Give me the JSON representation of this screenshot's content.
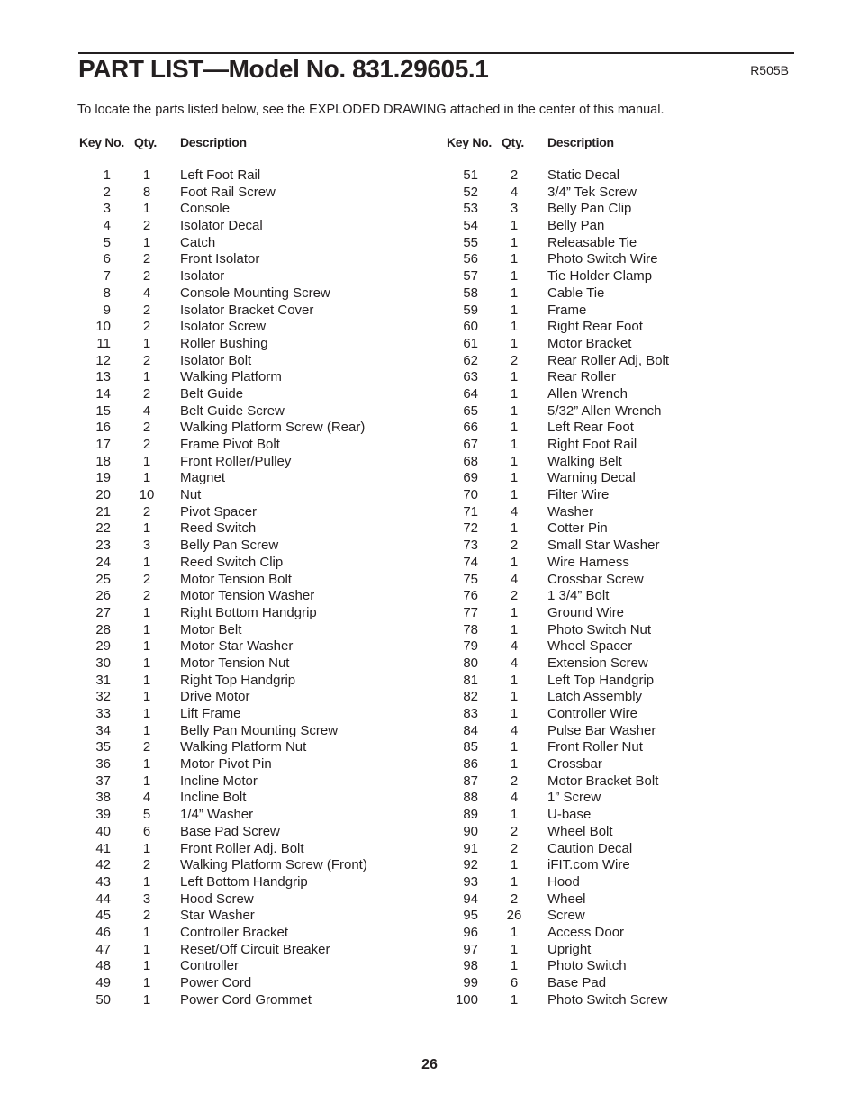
{
  "header": {
    "title": "PART LIST—Model No. 831.29605.1",
    "code": "R505B",
    "intro": "To locate the parts listed below, see the EXPLODED DRAWING attached in the center of this manual."
  },
  "columns": {
    "key": "Key No.",
    "qty": "Qty.",
    "desc": "Description"
  },
  "left_parts": [
    {
      "key": "1",
      "qty": "1",
      "desc": "Left Foot Rail"
    },
    {
      "key": "2",
      "qty": "8",
      "desc": "Foot Rail Screw"
    },
    {
      "key": "3",
      "qty": "1",
      "desc": "Console"
    },
    {
      "key": "4",
      "qty": "2",
      "desc": "Isolator Decal"
    },
    {
      "key": "5",
      "qty": "1",
      "desc": "Catch"
    },
    {
      "key": "6",
      "qty": "2",
      "desc": "Front Isolator"
    },
    {
      "key": "7",
      "qty": "2",
      "desc": "Isolator"
    },
    {
      "key": "8",
      "qty": "4",
      "desc": "Console Mounting Screw"
    },
    {
      "key": "9",
      "qty": "2",
      "desc": "Isolator Bracket Cover"
    },
    {
      "key": "10",
      "qty": "2",
      "desc": "Isolator Screw"
    },
    {
      "key": "11",
      "qty": "1",
      "desc": "Roller Bushing"
    },
    {
      "key": "12",
      "qty": "2",
      "desc": "Isolator Bolt"
    },
    {
      "key": "13",
      "qty": "1",
      "desc": "Walking Platform"
    },
    {
      "key": "14",
      "qty": "2",
      "desc": "Belt Guide"
    },
    {
      "key": "15",
      "qty": "4",
      "desc": "Belt Guide Screw"
    },
    {
      "key": "16",
      "qty": "2",
      "desc": "Walking Platform Screw (Rear)"
    },
    {
      "key": "17",
      "qty": "2",
      "desc": "Frame Pivot Bolt"
    },
    {
      "key": "18",
      "qty": "1",
      "desc": "Front Roller/Pulley"
    },
    {
      "key": "19",
      "qty": "1",
      "desc": "Magnet"
    },
    {
      "key": "20",
      "qty": "10",
      "desc": "Nut"
    },
    {
      "key": "21",
      "qty": "2",
      "desc": "Pivot Spacer"
    },
    {
      "key": "22",
      "qty": "1",
      "desc": "Reed Switch"
    },
    {
      "key": "23",
      "qty": "3",
      "desc": "Belly Pan Screw"
    },
    {
      "key": "24",
      "qty": "1",
      "desc": "Reed Switch Clip"
    },
    {
      "key": "25",
      "qty": "2",
      "desc": "Motor Tension Bolt"
    },
    {
      "key": "26",
      "qty": "2",
      "desc": "Motor Tension Washer"
    },
    {
      "key": "27",
      "qty": "1",
      "desc": "Right Bottom Handgrip"
    },
    {
      "key": "28",
      "qty": "1",
      "desc": "Motor Belt"
    },
    {
      "key": "29",
      "qty": "1",
      "desc": "Motor Star Washer"
    },
    {
      "key": "30",
      "qty": "1",
      "desc": "Motor Tension Nut"
    },
    {
      "key": "31",
      "qty": "1",
      "desc": "Right Top Handgrip"
    },
    {
      "key": "32",
      "qty": "1",
      "desc": "Drive Motor"
    },
    {
      "key": "33",
      "qty": "1",
      "desc": "Lift Frame"
    },
    {
      "key": "34",
      "qty": "1",
      "desc": "Belly Pan Mounting Screw"
    },
    {
      "key": "35",
      "qty": "2",
      "desc": "Walking Platform Nut"
    },
    {
      "key": "36",
      "qty": "1",
      "desc": "Motor Pivot Pin"
    },
    {
      "key": "37",
      "qty": "1",
      "desc": "Incline Motor"
    },
    {
      "key": "38",
      "qty": "4",
      "desc": "Incline Bolt"
    },
    {
      "key": "39",
      "qty": "5",
      "desc": "1/4” Washer"
    },
    {
      "key": "40",
      "qty": "6",
      "desc": "Base Pad Screw"
    },
    {
      "key": "41",
      "qty": "1",
      "desc": "Front Roller Adj. Bolt"
    },
    {
      "key": "42",
      "qty": "2",
      "desc": "Walking Platform Screw (Front)"
    },
    {
      "key": "43",
      "qty": "1",
      "desc": "Left Bottom Handgrip"
    },
    {
      "key": "44",
      "qty": "3",
      "desc": "Hood Screw"
    },
    {
      "key": "45",
      "qty": "2",
      "desc": "Star Washer"
    },
    {
      "key": "46",
      "qty": "1",
      "desc": "Controller Bracket"
    },
    {
      "key": "47",
      "qty": "1",
      "desc": "Reset/Off Circuit Breaker"
    },
    {
      "key": "48",
      "qty": "1",
      "desc": "Controller"
    },
    {
      "key": "49",
      "qty": "1",
      "desc": "Power Cord"
    },
    {
      "key": "50",
      "qty": "1",
      "desc": "Power Cord Grommet"
    }
  ],
  "right_parts": [
    {
      "key": "51",
      "qty": "2",
      "desc": "Static Decal"
    },
    {
      "key": "52",
      "qty": "4",
      "desc": "3/4” Tek Screw"
    },
    {
      "key": "53",
      "qty": "3",
      "desc": "Belly Pan Clip"
    },
    {
      "key": "54",
      "qty": "1",
      "desc": "Belly Pan"
    },
    {
      "key": "55",
      "qty": "1",
      "desc": "Releasable Tie"
    },
    {
      "key": "56",
      "qty": "1",
      "desc": "Photo Switch Wire"
    },
    {
      "key": "57",
      "qty": "1",
      "desc": "Tie Holder Clamp"
    },
    {
      "key": "58",
      "qty": "1",
      "desc": "Cable Tie"
    },
    {
      "key": "59",
      "qty": "1",
      "desc": "Frame"
    },
    {
      "key": "60",
      "qty": "1",
      "desc": "Right Rear Foot"
    },
    {
      "key": "61",
      "qty": "1",
      "desc": "Motor Bracket"
    },
    {
      "key": "62",
      "qty": "2",
      "desc": "Rear Roller Adj, Bolt"
    },
    {
      "key": "63",
      "qty": "1",
      "desc": "Rear Roller"
    },
    {
      "key": "64",
      "qty": "1",
      "desc": "Allen Wrench"
    },
    {
      "key": "65",
      "qty": "1",
      "desc": "5/32” Allen Wrench"
    },
    {
      "key": "66",
      "qty": "1",
      "desc": "Left Rear Foot"
    },
    {
      "key": "67",
      "qty": "1",
      "desc": "Right Foot Rail"
    },
    {
      "key": "68",
      "qty": "1",
      "desc": "Walking Belt"
    },
    {
      "key": "69",
      "qty": "1",
      "desc": "Warning Decal"
    },
    {
      "key": "70",
      "qty": "1",
      "desc": "Filter Wire"
    },
    {
      "key": "71",
      "qty": "4",
      "desc": "Washer"
    },
    {
      "key": "72",
      "qty": "1",
      "desc": "Cotter Pin"
    },
    {
      "key": "73",
      "qty": "2",
      "desc": "Small Star Washer"
    },
    {
      "key": "74",
      "qty": "1",
      "desc": "Wire Harness"
    },
    {
      "key": "75",
      "qty": "4",
      "desc": "Crossbar Screw"
    },
    {
      "key": "76",
      "qty": "2",
      "desc": "1 3/4” Bolt"
    },
    {
      "key": "77",
      "qty": "1",
      "desc": "Ground Wire"
    },
    {
      "key": "78",
      "qty": "1",
      "desc": "Photo Switch Nut"
    },
    {
      "key": "79",
      "qty": "4",
      "desc": "Wheel Spacer"
    },
    {
      "key": "80",
      "qty": "4",
      "desc": "Extension Screw"
    },
    {
      "key": "81",
      "qty": "1",
      "desc": "Left Top Handgrip"
    },
    {
      "key": "82",
      "qty": "1",
      "desc": "Latch Assembly"
    },
    {
      "key": "83",
      "qty": "1",
      "desc": "Controller Wire"
    },
    {
      "key": "84",
      "qty": "4",
      "desc": "Pulse Bar Washer"
    },
    {
      "key": "85",
      "qty": "1",
      "desc": "Front Roller Nut"
    },
    {
      "key": "86",
      "qty": "1",
      "desc": "Crossbar"
    },
    {
      "key": "87",
      "qty": "2",
      "desc": "Motor Bracket Bolt"
    },
    {
      "key": "88",
      "qty": "4",
      "desc": "1” Screw"
    },
    {
      "key": "89",
      "qty": "1",
      "desc": "U-base"
    },
    {
      "key": "90",
      "qty": "2",
      "desc": "Wheel Bolt"
    },
    {
      "key": "91",
      "qty": "2",
      "desc": "Caution Decal"
    },
    {
      "key": "92",
      "qty": "1",
      "desc": "iFIT.com Wire"
    },
    {
      "key": "93",
      "qty": "1",
      "desc": "Hood"
    },
    {
      "key": "94",
      "qty": "2",
      "desc": "Wheel"
    },
    {
      "key": "95",
      "qty": "26",
      "desc": "Screw"
    },
    {
      "key": "96",
      "qty": "1",
      "desc": "Access Door"
    },
    {
      "key": "97",
      "qty": "1",
      "desc": "Upright"
    },
    {
      "key": "98",
      "qty": "1",
      "desc": "Photo Switch"
    },
    {
      "key": "99",
      "qty": "6",
      "desc": "Base Pad"
    },
    {
      "key": "100",
      "qty": "1",
      "desc": "Photo Switch Screw"
    }
  ],
  "footer": {
    "page_number": "26"
  }
}
